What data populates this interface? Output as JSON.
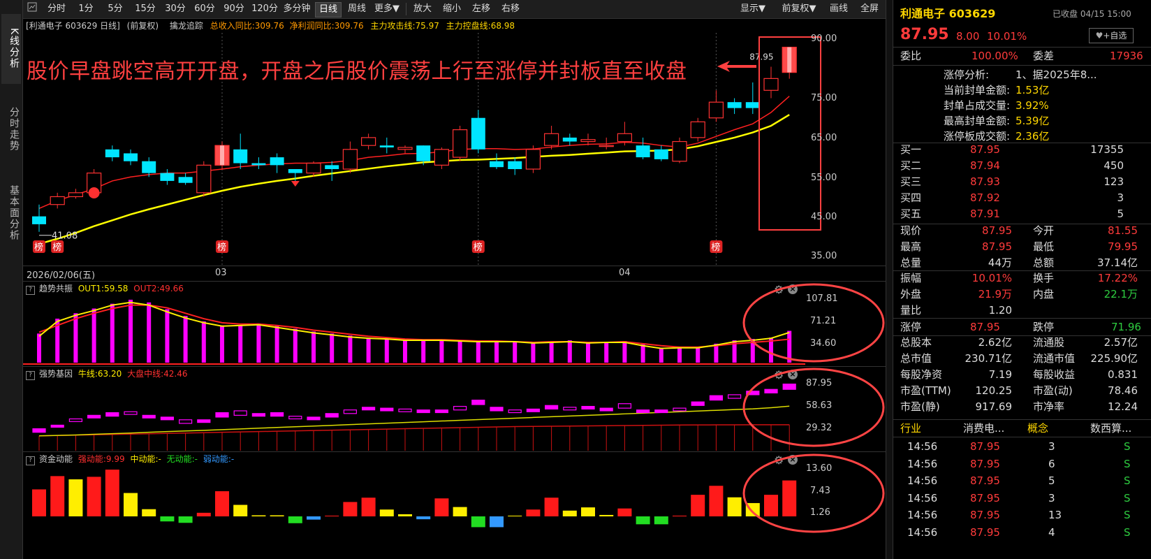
{
  "side_tabs": [
    "K线分析",
    "分时走势",
    "基本面分析"
  ],
  "toolbar": {
    "periods": [
      "分时",
      "1分",
      "5分",
      "15分",
      "30分",
      "60分",
      "90分",
      "120分",
      "多分钟",
      "日线",
      "周线",
      "更多▼"
    ],
    "selected": "日线",
    "actions": [
      "放大",
      "缩小",
      "左移",
      "右移"
    ],
    "right": [
      "显示▼",
      "前复权▼",
      "画线",
      "全屏"
    ]
  },
  "info": {
    "stock": "[利通电子 603629 日线]",
    "adj": "(前复权)",
    "indicator": "擒龙追踪",
    "rev": "总收入同比:309.76",
    "profit": "净利润同比:309.76",
    "attack": "主力攻击线:75.97",
    "control": "主力控盘线:68.98"
  },
  "annotation": "股价早盘跳空高开开盘，开盘之后股价震荡上行至涨停并封板直至收盘",
  "price_axis": [
    "90.00",
    "75.00",
    "65.00",
    "55.00",
    "45.00",
    "35.00"
  ],
  "low_label": "41.08",
  "high_label": "87.95",
  "bang_label": "榜",
  "dates": {
    "start": "2026/02/06(五)",
    "m1": "03",
    "m2": "04"
  },
  "panel1": {
    "name": "趋势共振",
    "out1": "OUT1:59.58",
    "out2": "OUT2:49.66",
    "axis": [
      "107.81",
      "71.21",
      "34.60"
    ]
  },
  "panel2": {
    "name": "强势基因",
    "l1": "牛线:63.20",
    "l2": "大盘中线:42.46",
    "axis": [
      "87.95",
      "58.63",
      "29.32"
    ]
  },
  "panel3": {
    "name": "资金动能",
    "l1": "强动能:9.99",
    "l2": "中动能:-",
    "l3": "无动能:-",
    "l4": "弱动能:-",
    "axis": [
      "13.60",
      "7.43",
      "1.26"
    ]
  },
  "colors": {
    "up": "#ff3232",
    "down": "#00e5ff",
    "ma1": "#ffff00",
    "ma2": "#ff2020",
    "magenta": "#ff00ff",
    "yellow": "#ffee00",
    "green": "#22dd22",
    "blue": "#3399ff",
    "circle": "#ff4444"
  },
  "chart_data": {
    "type": "candlestick",
    "candles": [
      [
        45,
        43,
        48,
        41.08
      ],
      [
        48,
        50,
        51,
        47
      ],
      [
        50,
        51,
        52,
        49.5
      ],
      [
        51,
        56,
        57,
        50
      ],
      [
        62,
        60,
        63,
        59
      ],
      [
        61,
        59,
        62,
        58
      ],
      [
        59,
        56,
        60,
        55
      ],
      [
        56,
        54,
        57,
        53
      ],
      [
        55,
        53.5,
        56,
        53
      ],
      [
        51,
        58,
        59,
        50
      ],
      [
        58,
        63,
        64,
        57
      ],
      [
        62,
        58.5,
        66,
        57
      ],
      [
        58.5,
        58,
        60,
        57
      ],
      [
        60,
        58,
        61,
        56
      ],
      [
        57,
        56,
        57,
        54
      ],
      [
        56,
        58.5,
        59,
        55
      ],
      [
        58,
        57,
        59,
        54
      ],
      [
        57,
        62,
        64,
        56
      ],
      [
        63,
        65,
        66,
        62
      ],
      [
        63,
        62.5,
        65,
        61
      ],
      [
        62,
        62.5,
        63,
        61
      ],
      [
        63,
        59,
        63,
        58
      ],
      [
        58,
        62,
        62.5,
        57
      ],
      [
        60,
        67,
        68,
        59
      ],
      [
        70,
        62,
        72,
        61
      ],
      [
        59,
        57.5,
        61,
        57
      ],
      [
        59,
        57,
        60,
        55.5
      ],
      [
        57,
        62,
        63,
        56
      ],
      [
        63,
        66,
        68,
        62
      ],
      [
        65,
        64,
        66,
        63
      ],
      [
        64,
        64.5,
        66,
        63
      ],
      [
        63,
        63,
        65,
        62
      ],
      [
        64,
        66,
        69,
        63
      ],
      [
        63,
        60,
        65,
        59.5
      ],
      [
        62,
        59.5,
        63,
        59
      ],
      [
        59,
        64,
        65,
        58.5
      ],
      [
        65,
        69,
        70,
        64
      ],
      [
        70,
        74,
        77,
        69
      ],
      [
        74,
        72.5,
        75,
        71
      ],
      [
        74,
        72.5,
        79,
        71
      ],
      [
        77,
        80,
        83,
        75
      ],
      [
        81.55,
        87.95,
        87.95,
        79.95
      ]
    ],
    "ma_short": [
      47,
      49,
      50.5,
      52,
      54,
      55,
      55.6,
      56,
      56,
      56.5,
      57,
      57.6,
      58,
      58.3,
      58.5,
      58.5,
      58.7,
      59.2,
      60,
      60.4,
      60.9,
      61,
      61.4,
      62,
      62.2,
      62.2,
      62,
      62.1,
      62.6,
      63,
      63.3,
      63.4,
      63.8,
      63.6,
      63,
      62.6,
      63.6,
      65.3,
      67,
      68.5,
      71.4,
      75.5
    ],
    "ma_long": [
      38,
      39.3,
      40.8,
      42.5,
      44,
      45.5,
      46.8,
      48,
      49.2,
      50.4,
      51.5,
      52.5,
      53.3,
      54,
      54.6,
      55.3,
      55.9,
      56.5,
      57.1,
      57.7,
      58.2,
      58.7,
      59,
      59.3,
      59.4,
      59.6,
      59.8,
      60.1,
      60.4,
      60.6,
      60.9,
      61.2,
      61.5,
      61.6,
      61.7,
      62,
      62.8,
      63.9,
      65,
      66.3,
      68,
      70.8
    ],
    "bang_idx": [
      0,
      1,
      10,
      24,
      37
    ],
    "panel1_bars": [
      58,
      80,
      88,
      95,
      102,
      108,
      104,
      94,
      84,
      76,
      70,
      70,
      73,
      69,
      65,
      61,
      58,
      55,
      52,
      51,
      48,
      49,
      49,
      48,
      47,
      46,
      46,
      45,
      46,
      48,
      45,
      45,
      47,
      42,
      37,
      38,
      38,
      43,
      48,
      50,
      52,
      62
    ],
    "panel1_out1": [
      54,
      76,
      85,
      92,
      100,
      104,
      100,
      90,
      81,
      74,
      69,
      70,
      71,
      67,
      63,
      59,
      56,
      53,
      51,
      50,
      48,
      48,
      48,
      47,
      46,
      46,
      46,
      44,
      45,
      46,
      44,
      45,
      45,
      40,
      36,
      37,
      37,
      41,
      46,
      48,
      51,
      59.58
    ],
    "panel1_out2": [
      60,
      70,
      80,
      88,
      95,
      100,
      100,
      96,
      88,
      80,
      74,
      72,
      72,
      70,
      67,
      63,
      60,
      57,
      54,
      52,
      50,
      49,
      49,
      48,
      47,
      47,
      46,
      45,
      46,
      46,
      45,
      45,
      46,
      43,
      40,
      38,
      38,
      40,
      43,
      45,
      47,
      49.66
    ],
    "panel2_boxes": [
      [
        34,
        38
      ],
      [
        40,
        42
      ],
      [
        46,
        49
      ],
      [
        50,
        53
      ],
      [
        52,
        56
      ],
      [
        54,
        57
      ],
      [
        50,
        53
      ],
      [
        48,
        51
      ],
      [
        44,
        48
      ],
      [
        45,
        48
      ],
      [
        51,
        56
      ],
      [
        53,
        58
      ],
      [
        52,
        55
      ],
      [
        52,
        56
      ],
      [
        49,
        52
      ],
      [
        48,
        51
      ],
      [
        51,
        55
      ],
      [
        55,
        59
      ],
      [
        59,
        62
      ],
      [
        58,
        61
      ],
      [
        57,
        60
      ],
      [
        56,
        59
      ],
      [
        56,
        59
      ],
      [
        59,
        63
      ],
      [
        65,
        70
      ],
      [
        58,
        62
      ],
      [
        56,
        59
      ],
      [
        57,
        60
      ],
      [
        60,
        64
      ],
      [
        59,
        62
      ],
      [
        60,
        63
      ],
      [
        58,
        61
      ],
      [
        61,
        66
      ],
      [
        56,
        59
      ],
      [
        56,
        59
      ],
      [
        58,
        61
      ],
      [
        64,
        68
      ],
      [
        70,
        75
      ],
      [
        72,
        76
      ],
      [
        76,
        80
      ],
      [
        78,
        82
      ],
      [
        82,
        87.95
      ]
    ],
    "panel2_niu": [
      30,
      30.5,
      31,
      31.8,
      32.5,
      33.2,
      34,
      34.8,
      35.5,
      36.2,
      37,
      37.8,
      38.6,
      39.4,
      40.2,
      41,
      41.8,
      42.6,
      43.4,
      44.2,
      45,
      45.8,
      46.6,
      47.4,
      48.2,
      49,
      49.8,
      50.6,
      51.4,
      52.2,
      53,
      53.8,
      54.6,
      55.4,
      56.2,
      57,
      57.8,
      58.6,
      59.4,
      60.2,
      61.5,
      63.2
    ],
    "panel2_red": [
      30,
      30.4,
      30.8,
      31.2,
      31.6,
      32,
      32.4,
      32.8,
      33.2,
      33.6,
      34,
      34.4,
      34.8,
      35.2,
      35.6,
      36,
      36.4,
      36.8,
      37.2,
      37.6,
      38,
      38.4,
      38.8,
      39.2,
      39.6,
      40,
      40.4,
      40.6,
      40.8,
      41,
      41.2,
      41.4,
      41.6,
      41.8,
      42,
      42.1,
      42.2,
      42.3,
      42.36,
      42.4,
      42.43,
      42.46
    ],
    "panel3_bars": [
      [
        7.5,
        "r"
      ],
      [
        11.2,
        "r"
      ],
      [
        10.3,
        "y"
      ],
      [
        11,
        "r"
      ],
      [
        13,
        "r"
      ],
      [
        6.5,
        "y"
      ],
      [
        2,
        "y"
      ],
      [
        -1.4,
        "g"
      ],
      [
        -1.8,
        "g"
      ],
      [
        1,
        "r"
      ],
      [
        7,
        "r"
      ],
      [
        3.2,
        "y"
      ],
      [
        0.3,
        "y"
      ],
      [
        0.3,
        "y"
      ],
      [
        -1.9,
        "g"
      ],
      [
        -0.9,
        "b"
      ],
      [
        0.2,
        "r"
      ],
      [
        4,
        "r"
      ],
      [
        5.2,
        "r"
      ],
      [
        1.9,
        "y"
      ],
      [
        0.6,
        "y"
      ],
      [
        -0.8,
        "b"
      ],
      [
        5,
        "r"
      ],
      [
        2.6,
        "y"
      ],
      [
        -3,
        "g"
      ],
      [
        -3,
        "b"
      ],
      [
        0.2,
        "y"
      ],
      [
        1.9,
        "r"
      ],
      [
        5.2,
        "r"
      ],
      [
        1.6,
        "y"
      ],
      [
        2.5,
        "y"
      ],
      [
        0.4,
        "y"
      ],
      [
        2.2,
        "r"
      ],
      [
        -2.2,
        "g"
      ],
      [
        -2.2,
        "g"
      ],
      [
        0.2,
        "r"
      ],
      [
        6,
        "r"
      ],
      [
        8.5,
        "r"
      ],
      [
        5.3,
        "y"
      ],
      [
        3.7,
        "y"
      ],
      [
        6,
        "r"
      ],
      [
        9.99,
        "r"
      ]
    ]
  },
  "rp": {
    "name": "利通电子 603629",
    "status": "已收盘 04/15 15:00",
    "price": "87.95",
    "chg": "8.00",
    "pct": "10.01%",
    "add_btn": "+自选",
    "wb_l": "委比",
    "wb_v": "100.00%",
    "wc_l": "委差",
    "wc_v": "17936",
    "zt_lines": [
      [
        "涨停分析:",
        "1、据2025年8..."
      ],
      [
        "当前封单金额:",
        "1.53亿"
      ],
      [
        "封单占成交量:",
        "3.92%"
      ],
      [
        "最高封单金额:",
        "5.39亿"
      ],
      [
        "涨停板成交额:",
        "2.36亿"
      ]
    ],
    "bids": [
      [
        "买一",
        "87.95",
        "17355"
      ],
      [
        "买二",
        "87.94",
        "450"
      ],
      [
        "买三",
        "87.93",
        "123"
      ],
      [
        "买四",
        "87.92",
        "3"
      ],
      [
        "买五",
        "87.91",
        "5"
      ]
    ],
    "stats1": [
      [
        "现价",
        "87.95",
        "今开",
        "81.55"
      ],
      [
        "最高",
        "87.95",
        "最低",
        "79.95"
      ],
      [
        "总量",
        "44万",
        "总额",
        "37.14亿"
      ]
    ],
    "stats2": [
      [
        "振幅",
        "10.01%",
        "换手",
        "17.22%"
      ],
      [
        "外盘",
        "21.9万",
        "内盘",
        "22.1万"
      ],
      [
        "量比",
        "1.20",
        "",
        ""
      ]
    ],
    "limit": [
      "涨停",
      "87.95",
      "跌停",
      "71.96"
    ],
    "stats3": [
      [
        "总股本",
        "2.62亿",
        "流通股",
        "2.57亿"
      ],
      [
        "总市值",
        "230.71亿",
        "流通市值",
        "225.90亿"
      ],
      [
        "每股净资",
        "7.19",
        "每股收益",
        "0.831"
      ],
      [
        "市盈(TTM)",
        "120.25",
        "市盈(动)",
        "78.46"
      ],
      [
        "市盈(静)",
        "917.69",
        "市净率",
        "12.24"
      ]
    ],
    "tags": [
      "行业",
      "消费电...",
      "概念",
      "数西算..."
    ],
    "ticks": [
      [
        "14:56",
        "87.95",
        "3",
        "S"
      ],
      [
        "14:56",
        "87.95",
        "6",
        "S"
      ],
      [
        "14:56",
        "87.95",
        "5",
        "S"
      ],
      [
        "14:56",
        "87.95",
        "3",
        "S"
      ],
      [
        "14:56",
        "87.95",
        "13",
        "S"
      ],
      [
        "14:56",
        "87.95",
        "4",
        "S"
      ]
    ]
  }
}
